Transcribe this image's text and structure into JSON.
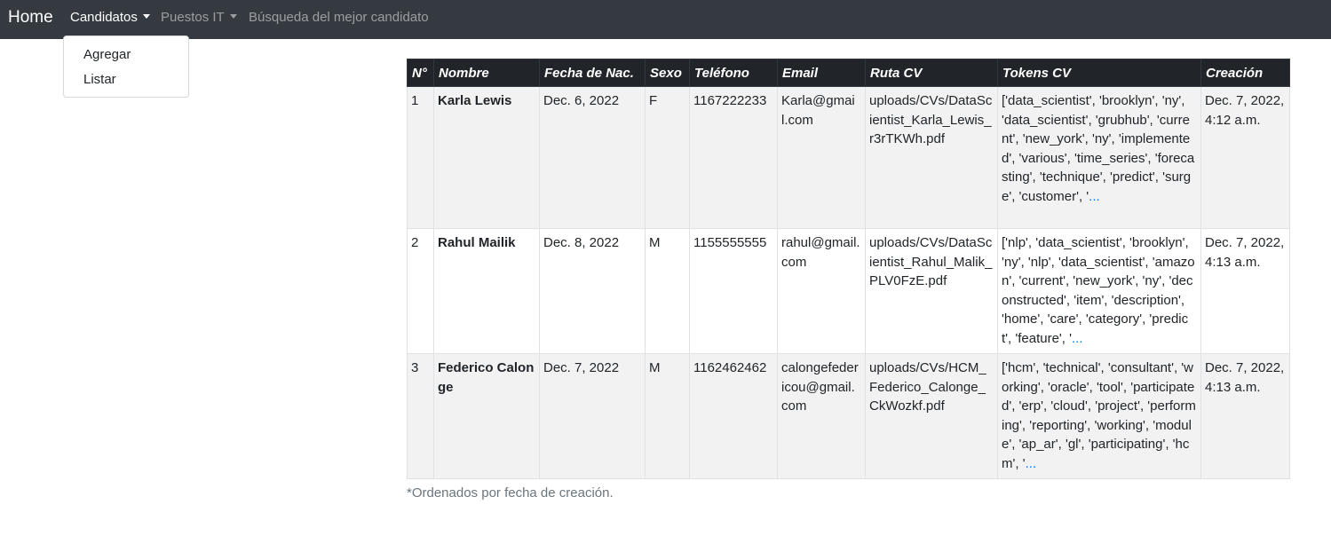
{
  "nav": {
    "brand": "Home",
    "candidatos": "Candidatos",
    "puestos": "Puestos IT",
    "busqueda": "Búsqueda del mejor candidato"
  },
  "dropdown": {
    "agregar": "Agregar",
    "listar": "Listar"
  },
  "table": {
    "headers": [
      "N°",
      "Nombre",
      "Fecha de Nac.",
      "Sexo",
      "Teléfono",
      "Email",
      "Ruta CV",
      "Tokens CV",
      "Creación"
    ],
    "rows": [
      {
        "n": "1",
        "nombre": "Karla Lewis",
        "fecha_nac": "Dec. 6, 2022",
        "sexo": "F",
        "telefono": "1167222233",
        "email": "Karla@gmail.com",
        "ruta_cv": "uploads/CVs/DataScientist_Karla_Lewis_r3rTKWh.pdf",
        "tokens": "['data_scientist', 'brooklyn', 'ny', 'data_scientist', 'grubhub', 'current', 'new_york', 'ny', 'implemented', 'various', 'time_series', 'forecasting', 'technique', 'predict', 'surge', 'customer', '",
        "more": "...",
        "creacion": "Dec. 7, 2022, 4:12 a.m."
      },
      {
        "n": "2",
        "nombre": "Rahul Mailik",
        "fecha_nac": "Dec. 8, 2022",
        "sexo": "M",
        "telefono": "1155555555",
        "email": "rahul@gmail.com",
        "ruta_cv": "uploads/CVs/DataScientist_Rahul_Malik_PLV0FzE.pdf",
        "tokens": "['nlp', 'data_scientist', 'brooklyn', 'ny', 'nlp', 'data_scientist', 'amazon', 'current', 'new_york', 'ny', 'deconstructed', 'item', 'description', 'home', 'care', 'category', 'predict', 'feature', '",
        "more": "...",
        "creacion": "Dec. 7, 2022, 4:13 a.m."
      },
      {
        "n": "3",
        "nombre": "Federico Calonge",
        "fecha_nac": "Dec. 7, 2022",
        "sexo": "M",
        "telefono": "1162462462",
        "email": "calongefedericou@gmail.com",
        "ruta_cv": "uploads/CVs/HCM_Federico_Calonge_CkWozkf.pdf",
        "tokens": "['hcm', 'technical', 'consultant', 'working', 'oracle', 'tool', 'participated', 'erp', 'cloud', 'project', 'performing', 'reporting', 'working', 'module', 'ap_ar', 'gl', 'participating', 'hcm', '",
        "more": "...",
        "creacion": "Dec. 7, 2022, 4:13 a.m."
      }
    ]
  },
  "footnote": "*Ordenados por fecha de creación."
}
